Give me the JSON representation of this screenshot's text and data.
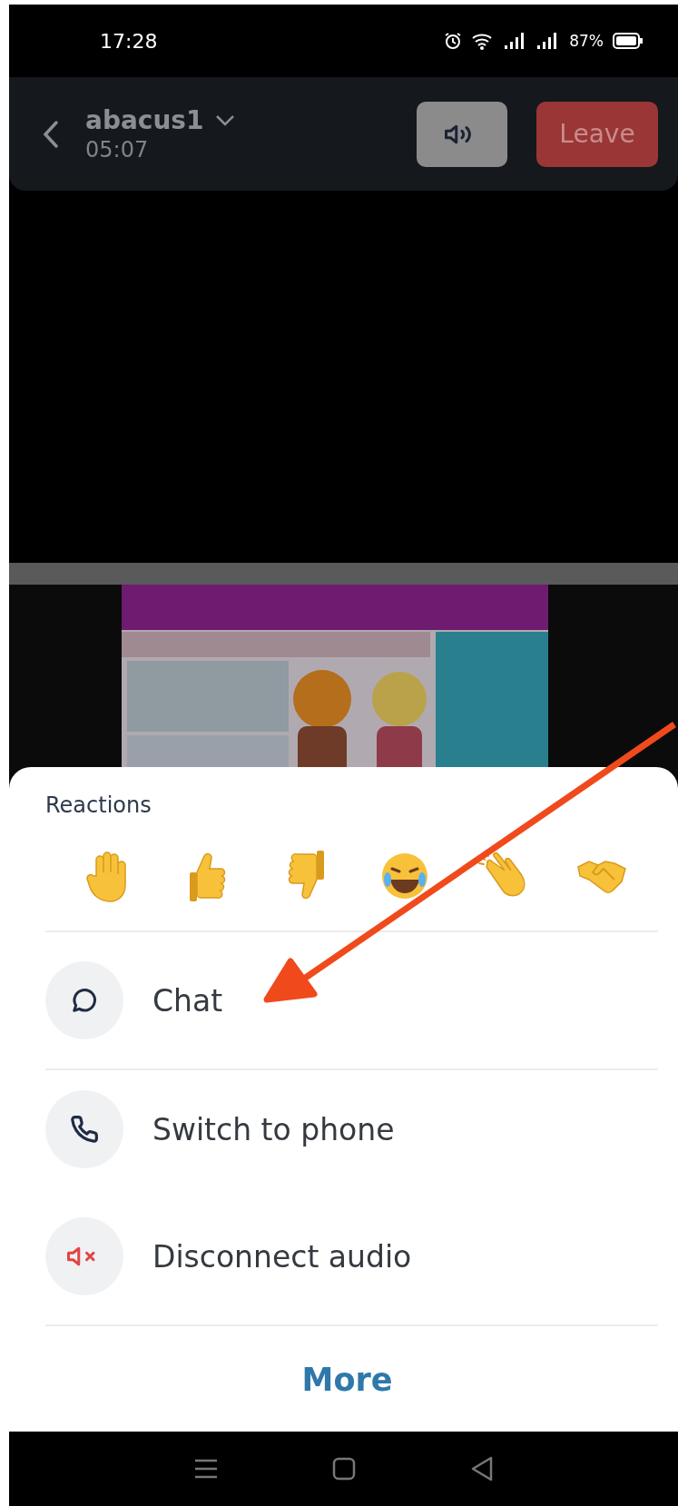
{
  "status_bar": {
    "time": "17:28",
    "battery": "87%"
  },
  "header": {
    "title": "abacus1",
    "duration": "05:07",
    "leave_button": "Leave"
  },
  "sheet": {
    "reactions_label": "Reactions",
    "reactions": [
      {
        "kind": "raised_hand"
      },
      {
        "kind": "thumbs_up"
      },
      {
        "kind": "thumbs_down"
      },
      {
        "kind": "laughing"
      },
      {
        "kind": "clapping"
      },
      {
        "kind": "handshake"
      }
    ],
    "actions": [
      {
        "label": "Chat",
        "kind": "chat",
        "divider_after": true
      },
      {
        "label": "Switch to phone",
        "kind": "phone",
        "divider_after": false
      },
      {
        "label": "Disconnect audio",
        "kind": "disconnect",
        "divider_after": true
      }
    ],
    "more": "More"
  }
}
